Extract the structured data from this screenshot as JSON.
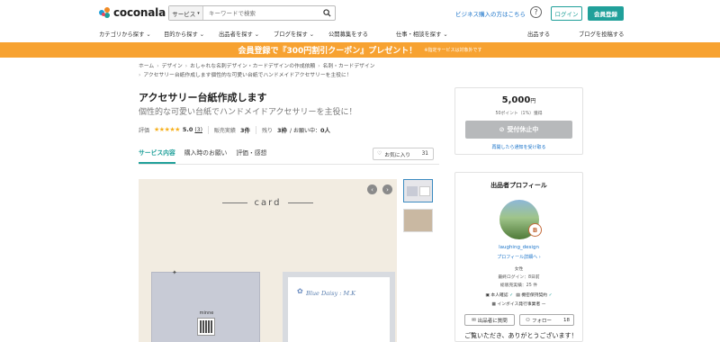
{
  "header": {
    "logo": "coconala",
    "search_category": "サービス",
    "search_placeholder": "キーワードで検索",
    "business_link": "ビジネス購入の方はこちら",
    "help": "?",
    "login": "ログイン",
    "signup": "会員登録"
  },
  "nav": {
    "categories": "カテゴリから探す",
    "purpose": "目的から探す",
    "sellers": "出品者を探す",
    "blog": "ブログを探す",
    "public_request": "公開募集をする",
    "jobs": "仕事・相談を探す",
    "sell": "出品する",
    "post_blog": "ブログを投稿する"
  },
  "promo": {
    "main": "会員登録で『300円割引クーポン』プレゼント！",
    "note": "※指定サービスは対象外です"
  },
  "breadcrumb": {
    "home": "ホーム",
    "design": "デザイン",
    "namecard": "おしゃれな名刺デザイン・カードデザインの作成依頼",
    "cat": "名刺・カードデザイン",
    "current": "アクセサリー台紙作成します個性的な可愛い台紙でハンドメイドアクセサリーを主役に！"
  },
  "service": {
    "title": "アクセサリー台紙作成します",
    "subtitle": "個性的な可愛い台紙でハンドメイドアクセサリーを主役に！",
    "rating_label": "評価",
    "rating": "5.0",
    "reviews": "(3)",
    "sales_label": "販売実績",
    "sales": "3件",
    "remain_label": "残り",
    "remain": "3枠",
    "busy_text": "/ お願い中：",
    "busy": "0人"
  },
  "tabs": [
    "サービス内容",
    "購入時のお願い",
    "評価・感想"
  ],
  "favorite": {
    "label": "お気に入り",
    "count": "31"
  },
  "gallery": {
    "card_title": "card",
    "brand": "minne",
    "script_text": "Blue Daisy : M.K"
  },
  "purchase": {
    "price": "5,000",
    "yen": "円",
    "points": "50ポイント（1%）獲得",
    "stopped": "受付休止中",
    "notify": "再開したら通知を受け取る"
  },
  "profile": {
    "heading": "出品者プロフィール",
    "badge": "B",
    "username": "laughing_design",
    "detail_link": "プロフィール詳細へ",
    "gender": "女性",
    "last_login": "最終ログイン：8日前",
    "total_sales": "総販売実績：25 件",
    "id_verified": "本人確認",
    "nda": "機密保持契約",
    "invoice": "インボイス発行事業者 ー",
    "message": "出品者に質問",
    "follow": "フォロー",
    "follow_count": "18",
    "greeting": "ご覧いただき、ありがとうございます！"
  },
  "colors": {
    "brand": "#20a09a",
    "promo": "#f7a231",
    "link": "#1a73c9",
    "star": "#f6b01e"
  }
}
